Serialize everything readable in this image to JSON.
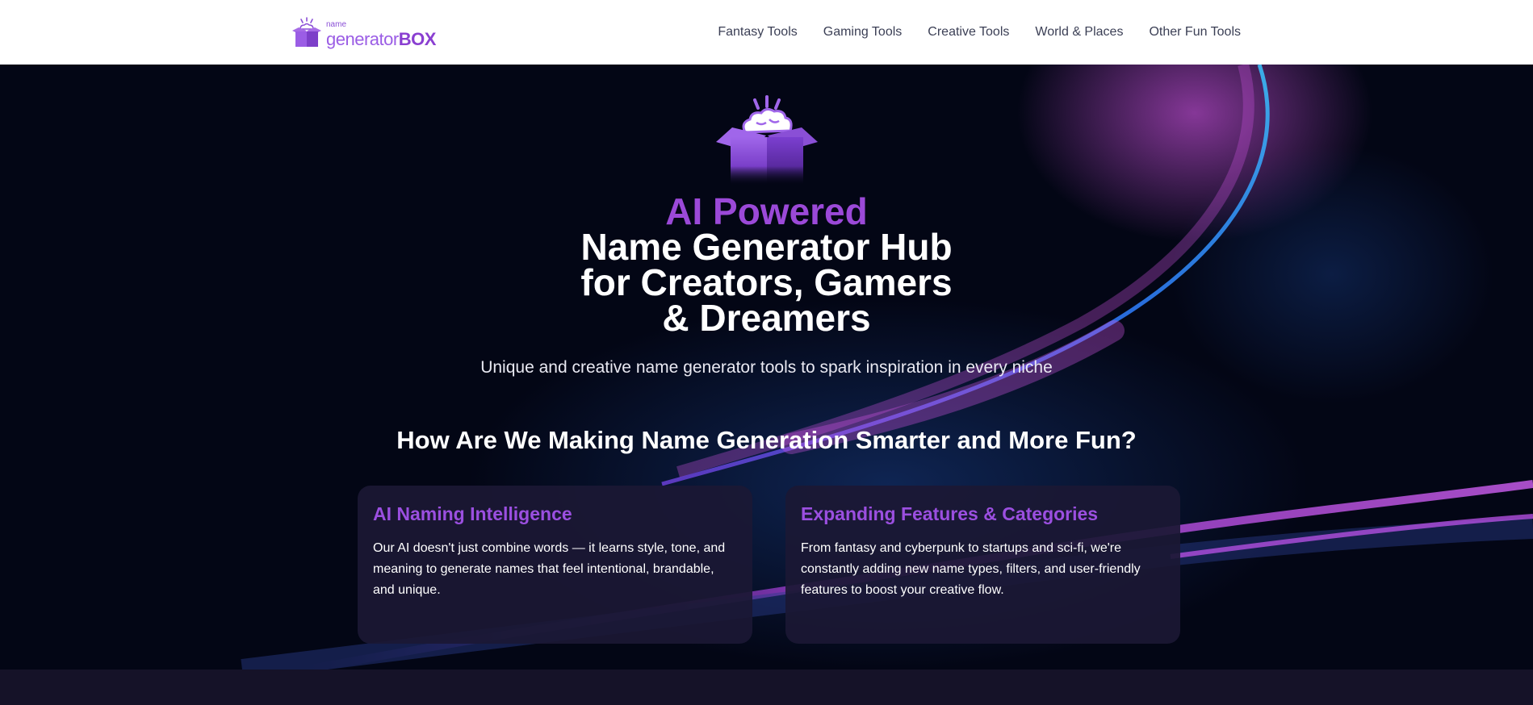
{
  "header": {
    "logo": {
      "small": "name",
      "main": "generator",
      "bold": "BOX"
    },
    "nav": [
      {
        "label": "Fantasy Tools"
      },
      {
        "label": "Gaming Tools"
      },
      {
        "label": "Creative Tools"
      },
      {
        "label": "World & Places"
      },
      {
        "label": "Other Fun Tools"
      }
    ]
  },
  "hero": {
    "title_accent": "AI Powered",
    "title_lines": [
      "Name Generator Hub",
      "for Creators, Gamers",
      "& Dreamers"
    ],
    "subtitle": "Unique and creative name generator tools to spark inspiration in every niche",
    "section_heading": "How Are We Making Name Generation Smarter and More Fun?",
    "cards": [
      {
        "title": "AI Naming Intelligence",
        "body": "Our AI doesn't just combine words — it learns style, tone, and meaning to generate names that feel intentional, brandable, and unique."
      },
      {
        "title": "Expanding Features & Categories",
        "body": "From fantasy and cyberpunk to startups and sci-fi, we're constantly adding new name types, filters, and user-friendly features to boost your creative flow."
      }
    ]
  },
  "icons": {
    "logo": "box-with-cloud-icon",
    "hero": "open-box-with-brain-icon"
  },
  "colors": {
    "accent": "#9b49d8",
    "hero_background": "#030615",
    "card_background": "#1b1834",
    "header_background": "#ffffff"
  }
}
